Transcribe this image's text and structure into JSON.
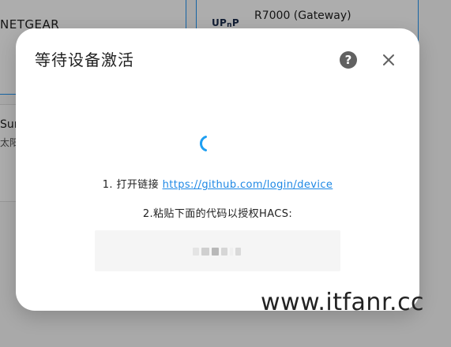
{
  "background": {
    "card_left_title": "NETGEAR",
    "upnp_logo": {
      "part1": "UP",
      "part2": "n",
      "part3": "P"
    },
    "device_name": "R7000 (Gateway)",
    "card_mid_title": "Sur",
    "card_mid_subtitle": "太阳"
  },
  "dialog": {
    "title": "等待设备激活",
    "help_icon": "help-circle-icon",
    "close_icon": "close-icon",
    "step1_prefix": "1. 打开链接",
    "step1_link": "https://github.com/login/device",
    "step2": "2.粘贴下面的代码以授权HACS:",
    "code_value_obscured": true
  },
  "watermark": "www.itfanr.cc",
  "colors": {
    "accent": "#2196f3",
    "link": "#1e88e5",
    "overlay": "rgba(0,0,0,0.32)",
    "code_bg": "#f5f5f5"
  }
}
